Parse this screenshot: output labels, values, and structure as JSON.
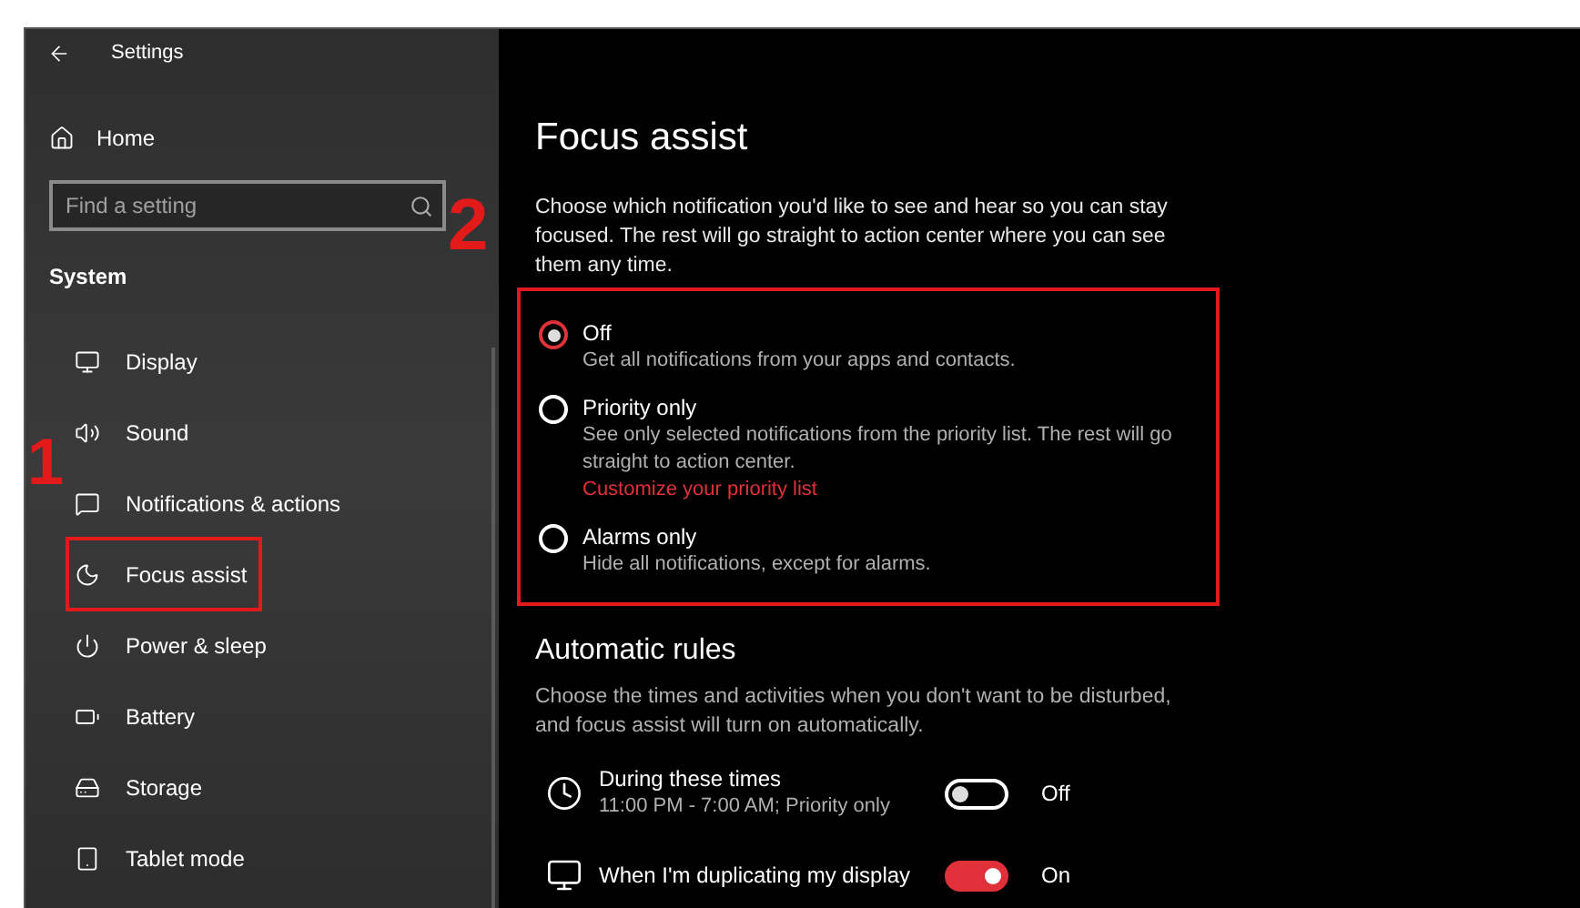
{
  "window": {
    "title": "Settings"
  },
  "sidebar": {
    "home": "Home",
    "search": {
      "placeholder": "Find a setting"
    },
    "section": "System",
    "items": [
      {
        "label": "Display",
        "kind": "display",
        "boxed": false
      },
      {
        "label": "Sound",
        "kind": "sound",
        "boxed": false
      },
      {
        "label": "Notifications & actions",
        "kind": "notifications",
        "boxed": false
      },
      {
        "label": "Focus assist",
        "kind": "moon",
        "boxed": true
      },
      {
        "label": "Power & sleep",
        "kind": "power",
        "boxed": false
      },
      {
        "label": "Battery",
        "kind": "battery",
        "boxed": false
      },
      {
        "label": "Storage",
        "kind": "storage",
        "boxed": false
      },
      {
        "label": "Tablet mode",
        "kind": "tablet",
        "boxed": false
      }
    ]
  },
  "content": {
    "title": "Focus assist",
    "description": "Choose which notification you'd like to see and hear so you can stay focused. The rest will go straight to action center where you can see them any time.",
    "options_boxed": true,
    "options": [
      {
        "label": "Off",
        "description": "Get all notifications from your apps and contacts.",
        "selected": true
      },
      {
        "label": "Priority only",
        "description": "See only selected notifications from the priority list. The rest will go straight to action center.",
        "link": "Customize your priority list",
        "selected": false
      },
      {
        "label": "Alarms only",
        "description": "Hide all notifications, except for alarms.",
        "selected": false
      }
    ],
    "automatic_rules": {
      "title": "Automatic rules",
      "description": "Choose the times and activities when you don't want to be disturbed, and focus assist will turn on automatically.",
      "rules": [
        {
          "kind": "clock",
          "title": "During these times",
          "subtitle": "11:00 PM - 7:00 AM; Priority only",
          "on": false,
          "state_text": "Off"
        },
        {
          "kind": "display",
          "title": "When I'm duplicating my display",
          "on": true,
          "state_text": "On"
        }
      ]
    }
  },
  "annotations": [
    {
      "label": "1"
    },
    {
      "label": "2"
    }
  ]
}
